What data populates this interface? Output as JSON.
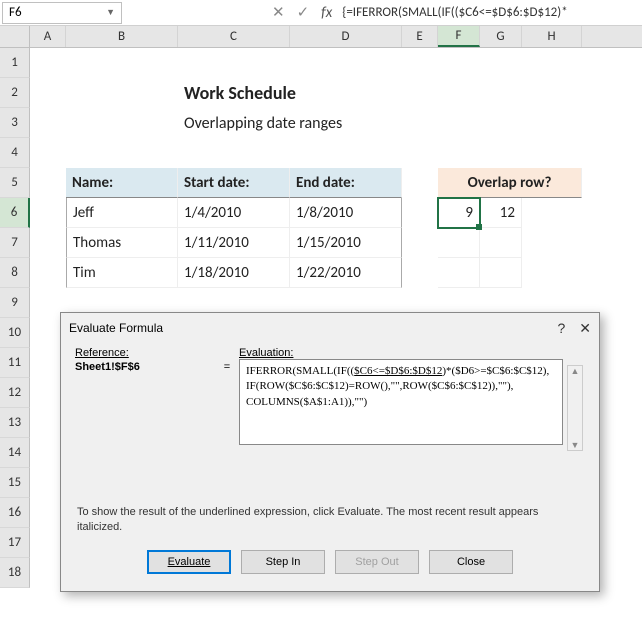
{
  "namebox": {
    "value": "F6"
  },
  "formula_preview": "{=IFERROR(SMALL(IF(($C6<=$D$6:$D$12)*",
  "columns": [
    "A",
    "B",
    "C",
    "D",
    "E",
    "F",
    "G",
    "H"
  ],
  "rows": [
    "1",
    "2",
    "3",
    "4",
    "5",
    "6",
    "7",
    "8",
    "9",
    "10",
    "11",
    "12",
    "13",
    "14",
    "15",
    "16",
    "17",
    "18"
  ],
  "title": "Work Schedule",
  "subtitle": "Overlapping date ranges",
  "headers": {
    "name": "Name:",
    "start": "Start date:",
    "end": "End date:",
    "overlap": "Overlap row?"
  },
  "data": [
    {
      "name": "Jeff",
      "start": "1/4/2010",
      "end": "1/8/2010",
      "o1": "9",
      "o2": "12"
    },
    {
      "name": "Thomas",
      "start": "1/11/2010",
      "end": "1/15/2010",
      "o1": "",
      "o2": ""
    },
    {
      "name": "Tim",
      "start": "1/18/2010",
      "end": "1/22/2010",
      "o1": "",
      "o2": ""
    }
  ],
  "dialog": {
    "title": "Evaluate Formula",
    "ref_label": "Reference:",
    "ref_value": "Sheet1!$F$6",
    "eval_label": "Evaluation:",
    "eval_before": "IFERROR(SMALL(IF((",
    "eval_underlined": "$C6<=$D$6:$D$12",
    "eval_after": ")*($D6>=$C$6:$C$12),\nIF(ROW($C$6:$C$12)=ROW(),\"\",ROW($C$6:$C$12)),\"\"),\nCOLUMNS($A$1:A1)),\"\")",
    "hint": "To show the result of the underlined expression, click Evaluate.  The most recent result appears italicized.",
    "btn_evaluate": "Evaluate",
    "btn_stepin": "Step In",
    "btn_stepout": "Step Out",
    "btn_close": "Close"
  }
}
